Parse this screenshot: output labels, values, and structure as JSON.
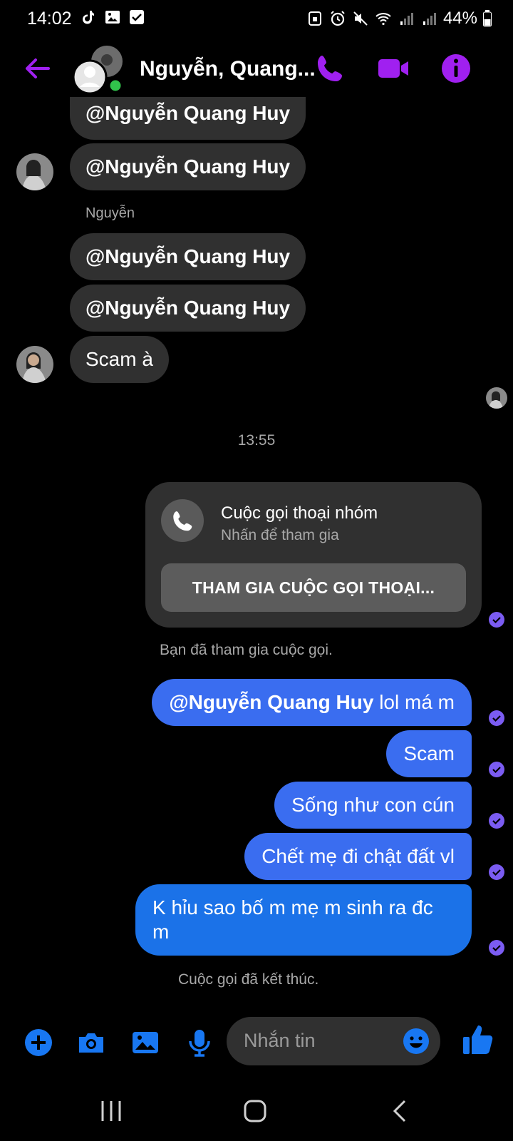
{
  "status_bar": {
    "time": "14:02",
    "battery": "44%"
  },
  "header": {
    "contact_name": "Nguyễn, Quang..."
  },
  "messages_in": {
    "top_partial": "@Nguyễn Quang Huy",
    "msg1": "@Nguyễn Quang Huy",
    "sender": "Nguyễn",
    "msg2": "@Nguyễn Quang Huy",
    "msg3": "@Nguyễn Quang Huy",
    "msg4": "Scam à"
  },
  "timestamp": "13:55",
  "call_card": {
    "title": "Cuộc gọi thoại nhóm",
    "subtitle": "Nhấn để tham gia",
    "join_label": "THAM GIA CUỘC GỌI THOẠI..."
  },
  "system_joined": "Bạn đã tham gia cuộc gọi.",
  "messages_out": {
    "m1_mention": "@Nguyễn Quang Huy",
    "m1_text": " lol má m",
    "m2": "Scam",
    "m3": "Sống như con cún",
    "m4": "Chết mẹ đi chật đất vl",
    "m5_line1": "K hỉu sao bố m mẹ m sinh ra đc",
    "m5_line2": "m"
  },
  "system_ended": "Cuộc gọi đã kết thúc.",
  "composer": {
    "placeholder": "Nhắn tin"
  },
  "colors": {
    "accent_purple": "#a020f0",
    "bubble_blue": "#3a6df0",
    "incoming_gray": "#303030",
    "tool_blue": "#1877f2"
  }
}
